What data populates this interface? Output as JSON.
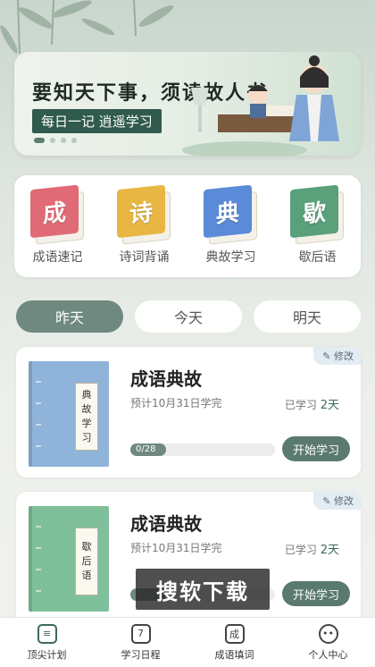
{
  "banner": {
    "title": "要知天下事，须读故人书",
    "subtitle": "每日一记 逍遥学习",
    "slides": 4,
    "active_slide": 1
  },
  "categories": [
    {
      "glyph": "成",
      "label": "成语速记",
      "color": "#e06a75"
    },
    {
      "glyph": "诗",
      "label": "诗词背诵",
      "color": "#e8b642"
    },
    {
      "glyph": "典",
      "label": "典故学习",
      "color": "#5b8ad8"
    },
    {
      "glyph": "歇",
      "label": "歇后语",
      "color": "#5aa07a"
    }
  ],
  "day_tabs": [
    {
      "label": "昨天",
      "active": true
    },
    {
      "label": "今天",
      "active": false
    },
    {
      "label": "明天",
      "active": false
    }
  ],
  "plans": [
    {
      "title": "成语典故",
      "cover_text": [
        "典",
        "故",
        "学",
        "习"
      ],
      "cover_color": "#8fb3d9",
      "edit_label": "修改",
      "date_text": "预计10月31日学完",
      "studied_prefix": "已学习",
      "studied_value": "2天",
      "progress_text": "0/28",
      "progress_fraction": 0.0,
      "button_label": "开始学习"
    },
    {
      "title": "成语典故",
      "cover_text": [
        "歇",
        "后",
        "语"
      ],
      "cover_color": "#7fbf9a",
      "edit_label": "修改",
      "date_text": "预计10月31日学完",
      "studied_prefix": "已学习",
      "studied_value": "2天",
      "progress_text": "",
      "progress_fraction": 0.0,
      "button_label": "开始学习"
    }
  ],
  "watermark": "搜软下载",
  "bottom_nav": [
    {
      "icon": "list-icon",
      "glyph": "≡",
      "label": "顶尖计划",
      "active": true
    },
    {
      "icon": "calendar-icon",
      "glyph": "7",
      "label": "学习日程",
      "active": false
    },
    {
      "icon": "idiom-icon",
      "glyph": "成",
      "label": "成语填词",
      "active": false
    },
    {
      "icon": "profile-icon",
      "glyph": "••",
      "label": "个人中心",
      "active": false
    }
  ]
}
